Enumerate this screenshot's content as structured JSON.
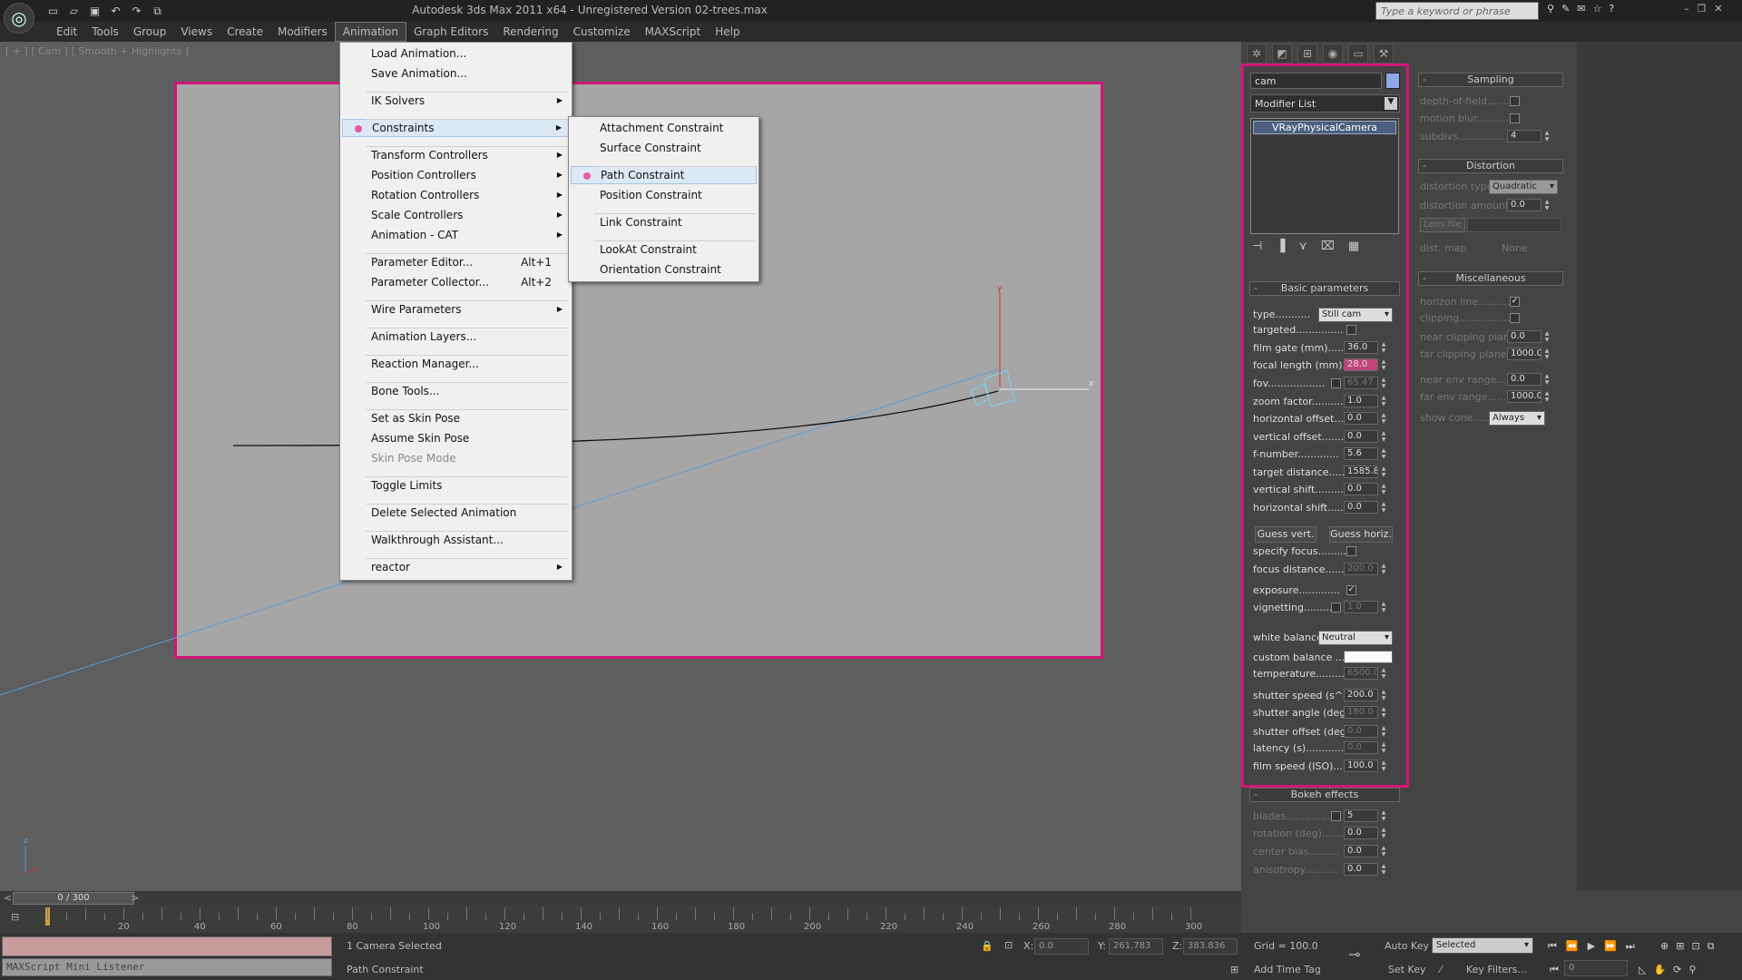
{
  "title": "Autodesk 3ds Max  2011 x64  -  Unregistered Version   02-trees.max",
  "search_placeholder": "Type a keyword or phrase",
  "menubar": [
    "Edit",
    "Tools",
    "Group",
    "Views",
    "Create",
    "Modifiers",
    "Animation",
    "Graph Editors",
    "Rendering",
    "Customize",
    "MAXScript",
    "Help"
  ],
  "viewport_label": "[ + ] [ Cam ] [ Smooth + Highlights ]",
  "animation_menu": [
    {
      "label": "Load Animation..."
    },
    {
      "label": "Save Animation..."
    },
    {
      "label": "IK Solvers",
      "sub": true
    },
    {
      "label": "Constraints",
      "sub": true,
      "dot": true
    },
    {
      "label": "Transform Controllers",
      "sub": true
    },
    {
      "label": "Position Controllers",
      "sub": true
    },
    {
      "label": "Rotation Controllers",
      "sub": true
    },
    {
      "label": "Scale Controllers",
      "sub": true
    },
    {
      "label": "Animation - CAT",
      "sub": true
    },
    {
      "label": "Parameter Editor...",
      "shortcut": "Alt+1"
    },
    {
      "label": "Parameter Collector...",
      "shortcut": "Alt+2"
    },
    {
      "label": "Wire Parameters",
      "sub": true
    },
    {
      "label": "Animation Layers..."
    },
    {
      "label": "Reaction Manager..."
    },
    {
      "label": "Bone Tools..."
    },
    {
      "label": "Set as Skin Pose"
    },
    {
      "label": "Assume Skin Pose"
    },
    {
      "label": "Skin Pose Mode",
      "disabled": true
    },
    {
      "label": "Toggle Limits"
    },
    {
      "label": "Delete Selected Animation"
    },
    {
      "label": "Walkthrough Assistant..."
    },
    {
      "label": "reactor",
      "sub": true
    }
  ],
  "constraints_menu": [
    {
      "label": "Attachment Constraint"
    },
    {
      "label": "Surface Constraint"
    },
    {
      "label": "Path Constraint",
      "dot": true,
      "highlight": true
    },
    {
      "label": "Position Constraint"
    },
    {
      "label": "Link Constraint"
    },
    {
      "label": "LookAt Constraint"
    },
    {
      "label": "Orientation Constraint"
    }
  ],
  "panel": {
    "object_name": "cam",
    "modifier_list": "Modifier List",
    "stack_item": "VRayPhysicalCamera",
    "basic_header": "Basic parameters",
    "type_label": "type...........",
    "type_value": "Still cam",
    "params": [
      {
        "label": "targeted...............",
        "cb": ""
      },
      {
        "label": "film gate (mm).......",
        "val": "36.0"
      },
      {
        "label": "focal length (mm)...",
        "val": "28.0",
        "pink": true
      },
      {
        "label": "fov..................",
        "val": "65.47",
        "dim": true,
        "cb": ""
      },
      {
        "label": "zoom factor..........",
        "val": "1.0"
      },
      {
        "label": "horizontal offset....",
        "val": "0.0"
      },
      {
        "label": "vertical offset.......",
        "val": "0.0"
      },
      {
        "label": "f-number.............",
        "val": "5.6"
      },
      {
        "label": "target distance......",
        "val": "1585.8"
      },
      {
        "label": "vertical shift.........",
        "val": "0.0"
      },
      {
        "label": "horizontal shift.......",
        "val": "0.0"
      }
    ],
    "guess_vert": "Guess vert.",
    "guess_horiz": "Guess horiz.",
    "params2": [
      {
        "label": "specify focus.........",
        "cb": ""
      },
      {
        "label": "focus distance......",
        "val": "200.0",
        "dim": true
      },
      {
        "label": "exposure.............",
        "cb": "✓"
      },
      {
        "label": "vignetting..........",
        "val": "1.0",
        "dim": true,
        "cb": ""
      }
    ],
    "white_balance_label": "white balance",
    "white_balance_value": "Neutral",
    "custom_balance_label": "custom balance .....",
    "params3": [
      {
        "label": "temperature..........",
        "val": "6500.0",
        "dim": true
      },
      {
        "label": "shutter speed (s^-1",
        "val": "200.0"
      },
      {
        "label": "shutter angle (deg).",
        "val": "180.0",
        "dim": true
      },
      {
        "label": "shutter offset (deg)",
        "val": "0.0",
        "dim": true
      },
      {
        "label": "latency (s)............",
        "val": "0.0",
        "dim": true
      },
      {
        "label": "film speed (ISO)......",
        "val": "100.0"
      }
    ],
    "bokeh_header": "Bokeh effects",
    "bokeh": [
      {
        "label": "blades...............",
        "val": "5",
        "cb": ""
      },
      {
        "label": "rotation (deg).......",
        "val": "0.0"
      },
      {
        "label": "center bias..........",
        "val": "0.0"
      },
      {
        "label": "anisotropy...........",
        "val": "0.0"
      }
    ],
    "sampling_header": "Sampling",
    "sampling": [
      {
        "label": "depth-of-field........",
        "cb": ""
      },
      {
        "label": "motion blur...........",
        "cb": ""
      },
      {
        "label": "subdivs...................",
        "val": "4"
      }
    ],
    "distortion_header": "Distortion",
    "distortion_type_label": "distortion type",
    "distortion_type_value": "Quadratic",
    "distortion_amount_label": "distortion amount...",
    "distortion_amount_value": "0.0",
    "lens_file": "Lens file",
    "dist_map_label": "dist. map",
    "dist_map_value": "None",
    "misc_header": "Miscellaneous",
    "misc": [
      {
        "label": "horizon line............",
        "cb": "✓"
      },
      {
        "label": "clipping..................",
        "cb": ""
      },
      {
        "label": "near clipping plane..",
        "val": "0.0"
      },
      {
        "label": "far clipping plane....",
        "val": "1000.0"
      },
      {
        "label": "near env range.......",
        "val": "0.0"
      },
      {
        "label": "far env range........",
        "val": "1000.0"
      }
    ],
    "show_cone_label": "show cone.........",
    "show_cone_value": "Always"
  },
  "timeline": {
    "frame": "0 / 300",
    "ticks": [
      "20",
      "40",
      "60",
      "80",
      "100",
      "120",
      "140",
      "160",
      "180",
      "200",
      "220",
      "240",
      "260",
      "280",
      "300"
    ]
  },
  "status": {
    "listener": "MAXScript Mini Listener",
    "selection": "1 Camera Selected",
    "prompt": "Path Constraint",
    "x_label": "X:",
    "x": "0.0",
    "y_label": "Y:",
    "y": "261.783",
    "z_label": "Z:",
    "z": "383.836",
    "grid": "Grid = 100.0",
    "add_time_tag": "Add Time Tag",
    "auto_key": "Auto Key",
    "set_key": "Set Key",
    "selected": "Selected",
    "key_filters": "Key Filters...",
    "frame_field": "0"
  }
}
